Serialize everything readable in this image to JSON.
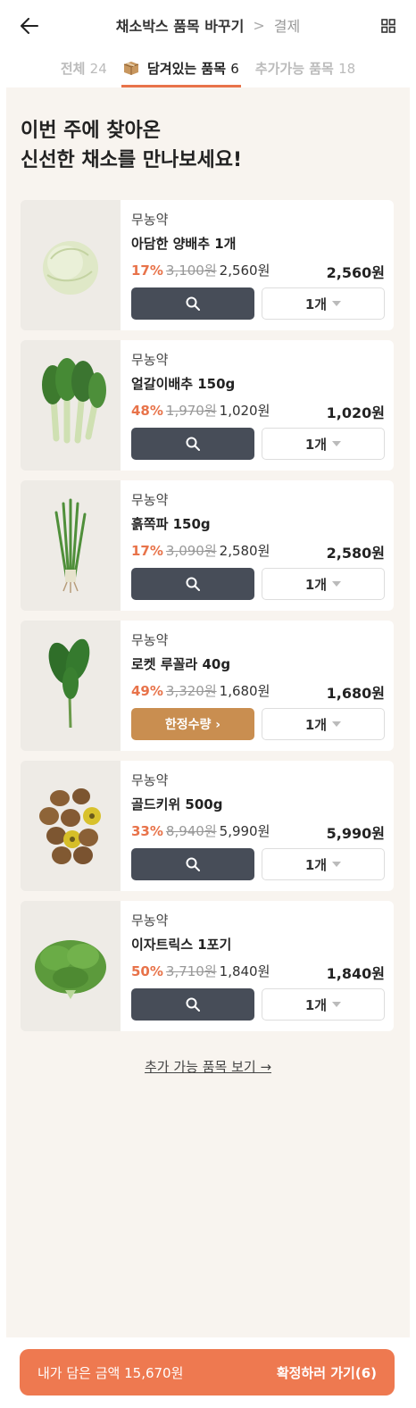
{
  "header": {
    "current_step": "채소박스 품목 바꾸기",
    "separator": ">",
    "next_step": "결제"
  },
  "tabs": [
    {
      "label": "전체",
      "count": "24"
    },
    {
      "label": "담겨있는 품목",
      "count": "6",
      "icon": "box-icon"
    },
    {
      "label": "추가가능 품목",
      "count": "18"
    }
  ],
  "headline": {
    "line1": "이번 주에 찾아온",
    "line2": "신선한 채소를 만나보세요!"
  },
  "items": [
    {
      "tag": "무농약",
      "name": "아담한 양배추 1개",
      "discount": "17%",
      "orig_price": "3,100원",
      "sale_price": "2,560원",
      "total": "2,560원",
      "qty": "1개",
      "limited": false
    },
    {
      "tag": "무농약",
      "name": "얼갈이배추 150g",
      "discount": "48%",
      "orig_price": "1,970원",
      "sale_price": "1,020원",
      "total": "1,020원",
      "qty": "1개",
      "limited": false
    },
    {
      "tag": "무농약",
      "name": "흙쪽파 150g",
      "discount": "17%",
      "orig_price": "3,090원",
      "sale_price": "2,580원",
      "total": "2,580원",
      "qty": "1개",
      "limited": false
    },
    {
      "tag": "무농약",
      "name": "로켓 루꼴라 40g",
      "discount": "49%",
      "orig_price": "3,320원",
      "sale_price": "1,680원",
      "total": "1,680원",
      "qty": "1개",
      "limited": true,
      "limited_label": "한정수량 ›"
    },
    {
      "tag": "무농약",
      "name": "골드키위 500g",
      "discount": "33%",
      "orig_price": "8,940원",
      "sale_price": "5,990원",
      "total": "5,990원",
      "qty": "1개",
      "limited": false
    },
    {
      "tag": "무농약",
      "name": "이자트릭스 1포기",
      "discount": "50%",
      "orig_price": "3,710원",
      "sale_price": "1,840원",
      "total": "1,840원",
      "qty": "1개",
      "limited": false
    }
  ],
  "more_link": "추가 가능 품목 보기 →",
  "cta": {
    "summary": "내가 담은 금액 15,670원",
    "confirm": "확정하러 가기(6)"
  },
  "colors": {
    "accent": "#e8734a",
    "cta": "#ee7950",
    "button_dark": "#474d58",
    "limited": "#c98e50",
    "background": "#f8f4ef"
  }
}
